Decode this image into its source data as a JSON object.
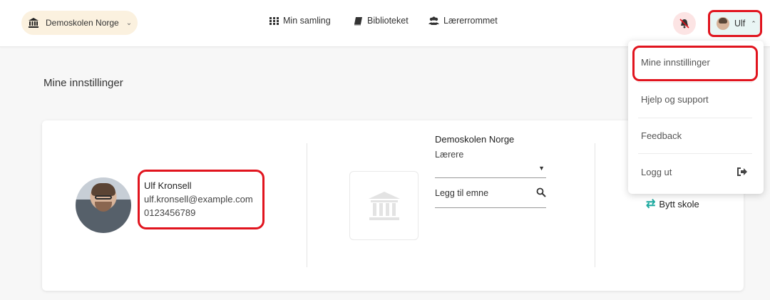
{
  "header": {
    "school_selector": {
      "label": "Demoskolen Norge"
    },
    "nav": [
      {
        "label": "Min samling",
        "icon": "grid-icon"
      },
      {
        "label": "Biblioteket",
        "icon": "book-icon"
      },
      {
        "label": "Lærerrommet",
        "icon": "users-icon"
      }
    ],
    "user_menu": {
      "label": "Ulf"
    }
  },
  "dropdown": {
    "items": [
      {
        "label": "Mine innstillinger"
      },
      {
        "label": "Hjelp og support"
      },
      {
        "label": "Feedback"
      },
      {
        "label": "Logg ut"
      }
    ]
  },
  "page": {
    "title": "Mine innstillinger"
  },
  "profile": {
    "name": "Ulf Kronsell",
    "email": "ulf.kronsell@example.com",
    "phone": "0123456789"
  },
  "school": {
    "name": "Demoskolen Norge",
    "role_label": "Lærere",
    "subject_placeholder": "Legg til emne",
    "switch_label": "Bytt skole"
  },
  "colors": {
    "highlight": "#e1141e",
    "accent": "#1eaaa0",
    "school_pill_bg": "#fbf1df",
    "user_btn_bg": "#e9f5f4"
  }
}
